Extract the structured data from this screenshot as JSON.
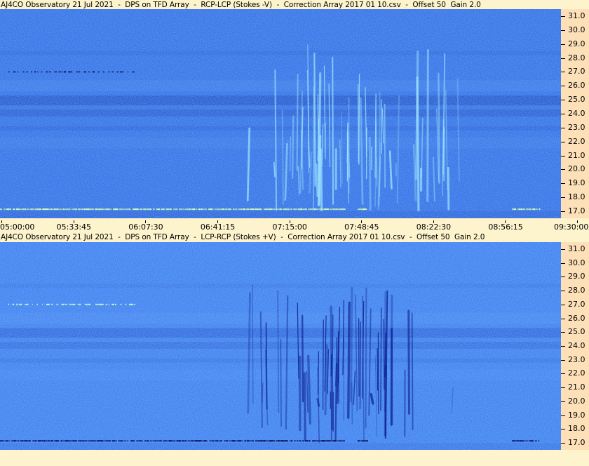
{
  "chart_data": [
    {
      "type": "heatmap",
      "title": "AJ4CO Observatory 21 Jul 2021  -  DPS on TFD Array  -  RCP-LCP (Stokes -V)  -  Correction Array 2017 01 10.csv  -  Offset 50  Gain 2.0",
      "x_tick_labels": [
        "05:00:00",
        "05:33:45",
        "06:07:30",
        "06:41:15",
        "07:15:00",
        "07:48:45",
        "08:22:30",
        "08:56:15",
        "09:30:00"
      ],
      "y_tick_labels": [
        "31.0",
        "30.0",
        "29.0",
        "28.0",
        "27.0",
        "26.0",
        "25.0",
        "24.0",
        "23.0",
        "22.0",
        "21.0",
        "20.0",
        "19.0",
        "18.0",
        "17.0"
      ],
      "ylim": [
        16.5,
        31.5
      ],
      "colors": {
        "base": "#2f6fe6",
        "band": "#1f52c8",
        "burst": "#9fe6ff"
      },
      "burst_polarity": "bright"
    },
    {
      "type": "heatmap",
      "title": "AJ4CO Observatory 21 Jul 2021  -  DPS on TFD Array  -  LCP-RCP (Stokes +V)  -  Correction Array 2017 01 10.csv  -  Offset 50  Gain 2.0",
      "y_tick_labels": [
        "31.0",
        "30.0",
        "29.0",
        "28.0",
        "27.0",
        "26.0",
        "25.0",
        "24.0",
        "23.0",
        "22.0",
        "21.0",
        "20.0",
        "19.0",
        "18.0",
        "17.0"
      ],
      "ylim": [
        16.5,
        31.5
      ],
      "colors": {
        "base": "#3a7ff0",
        "band": "#2a63d8",
        "burst": "#0a1a8a"
      },
      "burst_polarity": "dark"
    }
  ]
}
